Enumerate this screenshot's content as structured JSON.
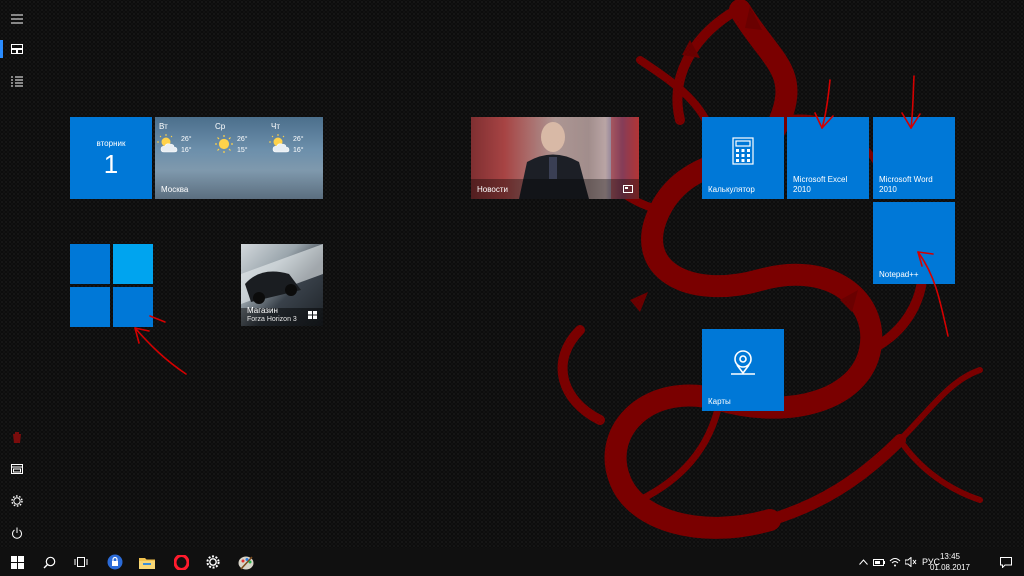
{
  "rail": {
    "items": [
      {
        "name": "menu-icon"
      },
      {
        "name": "tiles-icon"
      },
      {
        "name": "all-apps-icon"
      },
      {
        "name": "recent-app-icon"
      },
      {
        "name": "explorer-icon"
      },
      {
        "name": "settings-icon"
      },
      {
        "name": "power-icon"
      }
    ]
  },
  "tiles": {
    "calendar": {
      "day_name": "вторник",
      "day_num": "1"
    },
    "weather": {
      "label": "Москва",
      "days": [
        {
          "day": "Вт",
          "high": "26°",
          "low": "16°",
          "icon": "partly-cloudy-icon"
        },
        {
          "day": "Ср",
          "high": "26°",
          "low": "15°",
          "icon": "sun-icon"
        },
        {
          "day": "Чт",
          "high": "26°",
          "low": "16°",
          "icon": "partly-cloudy-icon"
        }
      ]
    },
    "news": {
      "label": "Новости"
    },
    "calculator": {
      "label": "Калькулятор"
    },
    "excel": {
      "label_line1": "Microsoft Excel",
      "label_line2": "2010"
    },
    "word": {
      "label_line1": "Microsoft Word",
      "label_line2": "2010"
    },
    "notepad": {
      "label": "Notepad++"
    },
    "store": {
      "label": "Магазин",
      "sublabel": "Forza Horizon 3"
    },
    "windows": {
      "icon": "windows-logo-icon"
    },
    "maps": {
      "label": "Карты"
    }
  },
  "taskbar": {
    "items": [
      {
        "name": "start-button"
      },
      {
        "name": "search-button"
      },
      {
        "name": "task-view-button"
      },
      {
        "name": "security-app-button"
      },
      {
        "name": "file-explorer-button"
      },
      {
        "name": "opera-button"
      },
      {
        "name": "settings-button"
      },
      {
        "name": "paint-button"
      }
    ],
    "language": "РУС",
    "time": "13:45",
    "date": "01.08.2017"
  },
  "colors": {
    "tile": "#0078d7",
    "tile_light": "#00a4ef",
    "taskbar": "#101010",
    "dragon": "#8a0000",
    "annotation": "#d40000"
  }
}
